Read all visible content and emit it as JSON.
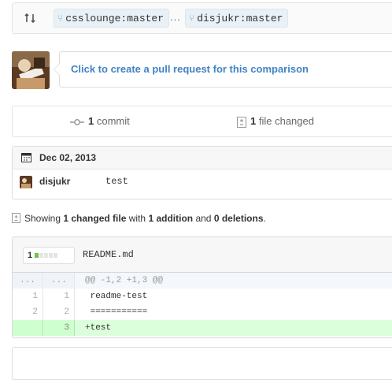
{
  "compare": {
    "base": "csslounge:master",
    "ellipsis": "...",
    "head": "disjukr:master"
  },
  "pull_request": {
    "prompt": "Click to create a pull request for this comparison"
  },
  "stats": {
    "commits_count": "1",
    "commits_label": "commit",
    "files_count": "1",
    "files_label": "file changed"
  },
  "commits": {
    "date": "Dec 02, 2013",
    "rows": [
      {
        "author": "disjukr",
        "message": "test"
      }
    ]
  },
  "summary": {
    "prefix": "Showing",
    "changed": "1 changed file",
    "with": "with",
    "additions": "1 addition",
    "and": "and",
    "deletions": "0 deletions",
    "end": "."
  },
  "file": {
    "additions": "1",
    "name": "README.md",
    "hunk_left": "...",
    "hunk_right": "...",
    "hunk": "@@ -1,2 +1,3 @@",
    "lines": [
      {
        "old": "1",
        "new": "1",
        "text": " readme-test"
      },
      {
        "old": "2",
        "new": "2",
        "text": " ==========="
      },
      {
        "old": "",
        "new": "3",
        "text": "+test"
      }
    ]
  },
  "colors": {
    "link": "#4183c4",
    "addition": "#6cc644",
    "addition_bg": "#dbffdb"
  }
}
